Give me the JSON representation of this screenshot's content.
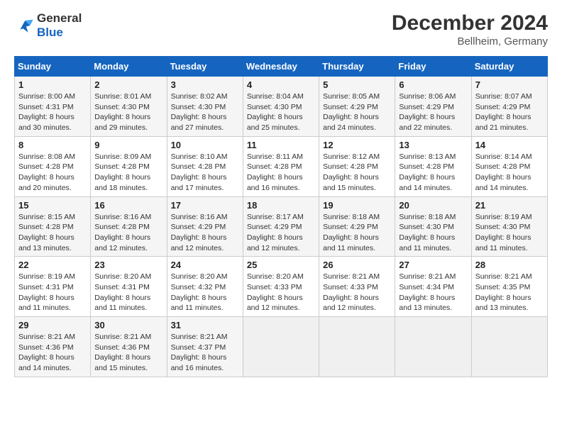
{
  "logo": {
    "line1": "General",
    "line2": "Blue"
  },
  "title": "December 2024",
  "location": "Bellheim, Germany",
  "headers": [
    "Sunday",
    "Monday",
    "Tuesday",
    "Wednesday",
    "Thursday",
    "Friday",
    "Saturday"
  ],
  "weeks": [
    [
      {
        "day": "1",
        "sunrise": "Sunrise: 8:00 AM",
        "sunset": "Sunset: 4:31 PM",
        "daylight": "Daylight: 8 hours and 30 minutes."
      },
      {
        "day": "2",
        "sunrise": "Sunrise: 8:01 AM",
        "sunset": "Sunset: 4:30 PM",
        "daylight": "Daylight: 8 hours and 29 minutes."
      },
      {
        "day": "3",
        "sunrise": "Sunrise: 8:02 AM",
        "sunset": "Sunset: 4:30 PM",
        "daylight": "Daylight: 8 hours and 27 minutes."
      },
      {
        "day": "4",
        "sunrise": "Sunrise: 8:04 AM",
        "sunset": "Sunset: 4:30 PM",
        "daylight": "Daylight: 8 hours and 25 minutes."
      },
      {
        "day": "5",
        "sunrise": "Sunrise: 8:05 AM",
        "sunset": "Sunset: 4:29 PM",
        "daylight": "Daylight: 8 hours and 24 minutes."
      },
      {
        "day": "6",
        "sunrise": "Sunrise: 8:06 AM",
        "sunset": "Sunset: 4:29 PM",
        "daylight": "Daylight: 8 hours and 22 minutes."
      },
      {
        "day": "7",
        "sunrise": "Sunrise: 8:07 AM",
        "sunset": "Sunset: 4:29 PM",
        "daylight": "Daylight: 8 hours and 21 minutes."
      }
    ],
    [
      {
        "day": "8",
        "sunrise": "Sunrise: 8:08 AM",
        "sunset": "Sunset: 4:28 PM",
        "daylight": "Daylight: 8 hours and 20 minutes."
      },
      {
        "day": "9",
        "sunrise": "Sunrise: 8:09 AM",
        "sunset": "Sunset: 4:28 PM",
        "daylight": "Daylight: 8 hours and 18 minutes."
      },
      {
        "day": "10",
        "sunrise": "Sunrise: 8:10 AM",
        "sunset": "Sunset: 4:28 PM",
        "daylight": "Daylight: 8 hours and 17 minutes."
      },
      {
        "day": "11",
        "sunrise": "Sunrise: 8:11 AM",
        "sunset": "Sunset: 4:28 PM",
        "daylight": "Daylight: 8 hours and 16 minutes."
      },
      {
        "day": "12",
        "sunrise": "Sunrise: 8:12 AM",
        "sunset": "Sunset: 4:28 PM",
        "daylight": "Daylight: 8 hours and 15 minutes."
      },
      {
        "day": "13",
        "sunrise": "Sunrise: 8:13 AM",
        "sunset": "Sunset: 4:28 PM",
        "daylight": "Daylight: 8 hours and 14 minutes."
      },
      {
        "day": "14",
        "sunrise": "Sunrise: 8:14 AM",
        "sunset": "Sunset: 4:28 PM",
        "daylight": "Daylight: 8 hours and 14 minutes."
      }
    ],
    [
      {
        "day": "15",
        "sunrise": "Sunrise: 8:15 AM",
        "sunset": "Sunset: 4:28 PM",
        "daylight": "Daylight: 8 hours and 13 minutes."
      },
      {
        "day": "16",
        "sunrise": "Sunrise: 8:16 AM",
        "sunset": "Sunset: 4:28 PM",
        "daylight": "Daylight: 8 hours and 12 minutes."
      },
      {
        "day": "17",
        "sunrise": "Sunrise: 8:16 AM",
        "sunset": "Sunset: 4:29 PM",
        "daylight": "Daylight: 8 hours and 12 minutes."
      },
      {
        "day": "18",
        "sunrise": "Sunrise: 8:17 AM",
        "sunset": "Sunset: 4:29 PM",
        "daylight": "Daylight: 8 hours and 12 minutes."
      },
      {
        "day": "19",
        "sunrise": "Sunrise: 8:18 AM",
        "sunset": "Sunset: 4:29 PM",
        "daylight": "Daylight: 8 hours and 11 minutes."
      },
      {
        "day": "20",
        "sunrise": "Sunrise: 8:18 AM",
        "sunset": "Sunset: 4:30 PM",
        "daylight": "Daylight: 8 hours and 11 minutes."
      },
      {
        "day": "21",
        "sunrise": "Sunrise: 8:19 AM",
        "sunset": "Sunset: 4:30 PM",
        "daylight": "Daylight: 8 hours and 11 minutes."
      }
    ],
    [
      {
        "day": "22",
        "sunrise": "Sunrise: 8:19 AM",
        "sunset": "Sunset: 4:31 PM",
        "daylight": "Daylight: 8 hours and 11 minutes."
      },
      {
        "day": "23",
        "sunrise": "Sunrise: 8:20 AM",
        "sunset": "Sunset: 4:31 PM",
        "daylight": "Daylight: 8 hours and 11 minutes."
      },
      {
        "day": "24",
        "sunrise": "Sunrise: 8:20 AM",
        "sunset": "Sunset: 4:32 PM",
        "daylight": "Daylight: 8 hours and 11 minutes."
      },
      {
        "day": "25",
        "sunrise": "Sunrise: 8:20 AM",
        "sunset": "Sunset: 4:33 PM",
        "daylight": "Daylight: 8 hours and 12 minutes."
      },
      {
        "day": "26",
        "sunrise": "Sunrise: 8:21 AM",
        "sunset": "Sunset: 4:33 PM",
        "daylight": "Daylight: 8 hours and 12 minutes."
      },
      {
        "day": "27",
        "sunrise": "Sunrise: 8:21 AM",
        "sunset": "Sunset: 4:34 PM",
        "daylight": "Daylight: 8 hours and 13 minutes."
      },
      {
        "day": "28",
        "sunrise": "Sunrise: 8:21 AM",
        "sunset": "Sunset: 4:35 PM",
        "daylight": "Daylight: 8 hours and 13 minutes."
      }
    ],
    [
      {
        "day": "29",
        "sunrise": "Sunrise: 8:21 AM",
        "sunset": "Sunset: 4:36 PM",
        "daylight": "Daylight: 8 hours and 14 minutes."
      },
      {
        "day": "30",
        "sunrise": "Sunrise: 8:21 AM",
        "sunset": "Sunset: 4:36 PM",
        "daylight": "Daylight: 8 hours and 15 minutes."
      },
      {
        "day": "31",
        "sunrise": "Sunrise: 8:21 AM",
        "sunset": "Sunset: 4:37 PM",
        "daylight": "Daylight: 8 hours and 16 minutes."
      },
      null,
      null,
      null,
      null
    ]
  ]
}
